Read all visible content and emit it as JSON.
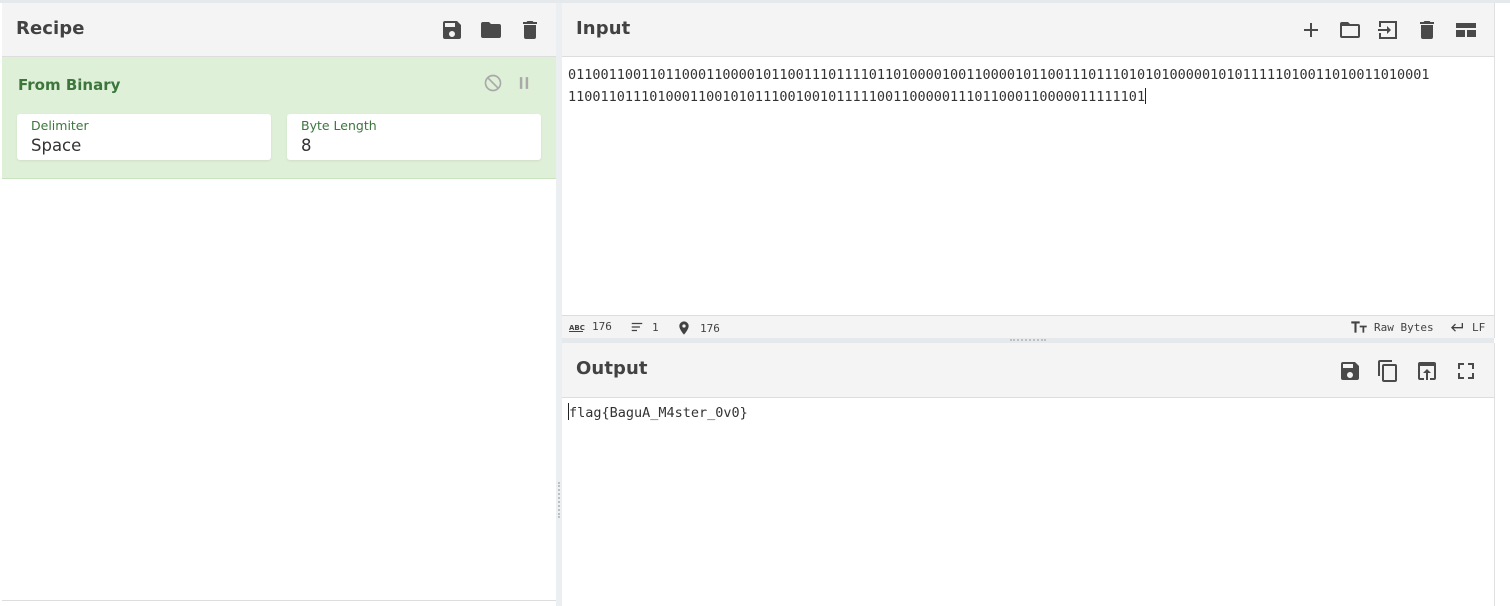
{
  "recipe": {
    "title": "Recipe",
    "buttons": [
      "save-icon",
      "folder-icon",
      "trash-icon"
    ],
    "operation": {
      "name": "From Binary",
      "args": [
        {
          "label": "Delimiter",
          "value": "Space"
        },
        {
          "label": "Byte Length",
          "value": "8"
        }
      ]
    }
  },
  "input": {
    "title": "Input",
    "buttons": [
      "plus-icon",
      "folder-icon",
      "insert-icon",
      "trash-icon",
      "layout-icon"
    ],
    "line1": "0110011001101100011000010110011101111011010000100110000101100111011101010100000101011111010011010011010001",
    "line2": "11001101110100011001010111001001011111001100000111011000110000011111101",
    "status": {
      "chars": "176",
      "lines": "1",
      "position": "176",
      "encoding": "Raw Bytes",
      "eol": "LF"
    }
  },
  "output": {
    "title": "Output",
    "buttons": [
      "save-icon",
      "copy-icon",
      "replace-input-icon",
      "maximise-icon"
    ],
    "text": "flag{BaguA_M4ster_0v0}"
  },
  "colors": {
    "operation_bg": "#dff0d8",
    "operation_text": "#3c763d",
    "header_bg": "#f4f4f4"
  }
}
